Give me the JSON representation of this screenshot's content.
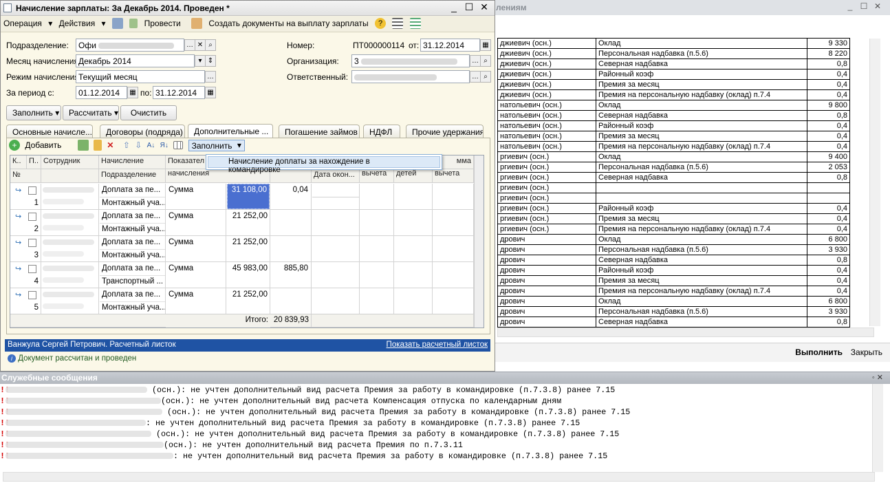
{
  "right_window": {
    "title_fragment": "лениям",
    "rows": [
      {
        "name": "джиевич  (осн.)",
        "type": "Оклад",
        "value": "9 330"
      },
      {
        "name": "джиевич  (осн.)",
        "type": "Персональная надбавка (п.5.6)",
        "value": "8 220"
      },
      {
        "name": "джиевич  (осн.)",
        "type": "Северная надбавка",
        "value": "0,8"
      },
      {
        "name": "джиевич  (осн.)",
        "type": "Районный коэф",
        "value": "0,4"
      },
      {
        "name": "джиевич  (осн.)",
        "type": "Премия за месяц",
        "value": "0,4"
      },
      {
        "name": "джиевич  (осн.)",
        "type": "Премия на персональную надбавку (оклад) п.7.4",
        "value": "0,4"
      },
      {
        "name": "натольевич  (осн.)",
        "type": "Оклад",
        "value": "9 800"
      },
      {
        "name": "натольевич  (осн.)",
        "type": "Северная надбавка",
        "value": "0,8"
      },
      {
        "name": "натольевич  (осн.)",
        "type": "Районный коэф",
        "value": "0,4"
      },
      {
        "name": "натольевич  (осн.)",
        "type": "Премия за месяц",
        "value": "0,4"
      },
      {
        "name": "натольевич  (осн.)",
        "type": "Премия на персональную надбавку (оклад) п.7.4",
        "value": "0,4"
      },
      {
        "name": "ргиевич  (осн.)",
        "type": "Оклад",
        "value": "9 400"
      },
      {
        "name": "ргиевич  (осн.)",
        "type": "Персональная надбавка (п.5.6)",
        "value": "2 053"
      },
      {
        "name": "ргиевич  (осн.)",
        "type": "Северная надбавка",
        "value": "0,8"
      },
      {
        "name": "ргиевич  (осн.)",
        "type": "",
        "value": ""
      },
      {
        "name": "ргиевич  (осн.)",
        "type": "",
        "value": ""
      },
      {
        "name": "ргиевич  (осн.)",
        "type": "Районный коэф",
        "value": "0,4"
      },
      {
        "name": "ргиевич  (осн.)",
        "type": "Премия за месяц",
        "value": "0,4"
      },
      {
        "name": "ргиевич  (осн.)",
        "type": "Премия на персональную надбавку (оклад) п.7.4",
        "value": "0,4"
      },
      {
        "name": "дрович",
        "type": "Оклад",
        "value": "6 800"
      },
      {
        "name": "дрович",
        "type": "Персональная надбавка (п.5.6)",
        "value": "3 930"
      },
      {
        "name": "дрович",
        "type": "Северная надбавка",
        "value": "0,8"
      },
      {
        "name": "дрович",
        "type": "Районный коэф",
        "value": "0,4"
      },
      {
        "name": "дрович",
        "type": "Премия за месяц",
        "value": "0,4"
      },
      {
        "name": "дрович",
        "type": "Премия на персональную надбавку (оклад) п.7.4",
        "value": "0,4"
      },
      {
        "name": "дрович",
        "type": "Оклад",
        "value": "6 800"
      },
      {
        "name": "дрович",
        "type": "Персональная надбавка (п.5.6)",
        "value": "3 930"
      },
      {
        "name": "дрович",
        "type": "Северная надбавка",
        "value": "0,8"
      }
    ],
    "run_label": "Выполнить",
    "close_label": "Закрыть"
  },
  "main": {
    "title": "Начисление зарплаты: За Декабрь 2014. Проведен *",
    "toolbar": {
      "operation": "Операция",
      "actions": "Действия",
      "post": "Провести",
      "create_docs": "Создать документы на выплату зарплаты"
    },
    "form": {
      "department_label": "Подразделение:",
      "department_value": "Офи",
      "month_label": "Месяц начисления:",
      "month_value": "Декабрь 2014",
      "mode_label": "Режим начисления:",
      "mode_value": "Текущий месяц",
      "period_label": "За период с:",
      "period_from": "01.12.2014",
      "period_to_label": "по:",
      "period_to": "31.12.2014",
      "number_label": "Номер:",
      "number_value": "ПТ000000114",
      "date_label": "от:",
      "date_value": "31.12.2014",
      "org_label": "Организация:",
      "org_value": "3",
      "resp_label": "Ответственный:"
    },
    "buttons": {
      "fill": "Заполнить",
      "calc": "Рассчитать",
      "clear": "Очистить"
    },
    "tabs": [
      "Основные начисле...",
      "Договоры (подряда)",
      "Дополнительные ...",
      "Погашение займов",
      "НДФЛ",
      "Прочие удержания"
    ],
    "grid_toolbar": {
      "add": "Добавить",
      "fill": "Заполнить"
    },
    "dropdown_item": "Начисление доплаты за нахождение в командировке",
    "grid_headers": {
      "k": "К..",
      "p": "П..",
      "employee": "Сотрудник",
      "no": "№",
      "accrual": "Начисление",
      "department": "Подразделение",
      "indicator": "Показател",
      "indicator2": "начисления",
      "end_date": "Дата окон...",
      "deduct": "вычета",
      "children": "детей",
      "sum_fragment": "мма",
      "deduct2": "вычета"
    },
    "grid_rows": [
      {
        "n": "1",
        "accrual": "Доплата за пе...",
        "dept": "Монтажный уча...",
        "indicator": "Сумма",
        "amount": "31 108,00",
        "extra": "0,04"
      },
      {
        "n": "2",
        "accrual": "Доплата за пе...",
        "dept": "Монтажный уча...",
        "indicator": "Сумма",
        "amount": "21 252,00",
        "extra": ""
      },
      {
        "n": "3",
        "accrual": "Доплата за пе...",
        "dept": "Монтажный уча...",
        "indicator": "Сумма",
        "amount": "21 252,00",
        "extra": ""
      },
      {
        "n": "4",
        "accrual": "Доплата за пе...",
        "dept": "Транспортный ...",
        "indicator": "Сумма",
        "amount": "45 983,00",
        "extra": "885,80"
      },
      {
        "n": "5",
        "accrual": "Доплата за пе...",
        "dept": "Монтажный уча...",
        "indicator": "Сумма",
        "amount": "21 252,00",
        "extra": ""
      }
    ],
    "total_label": "Итого:",
    "total_value": "20 839,93",
    "payslip_text": "Ванжула Сергей Петрович. Расчетный листок",
    "payslip_link": "Показать расчетный листок",
    "status_text": "Документ рассчитан и проведен"
  },
  "messages": {
    "title": "Служебные сообщения",
    "lines": [
      " (осн.): не учтен дополнительный вид расчета Премия за работу в командировке (п.7.3.8) ранее 7.15",
      "(осн.): не учтен дополнительный вид расчета Компенсация отпуска по календарным дням",
      " (осн.): не учтен дополнительный вид расчета Премия за работу в командировке (п.7.3.8) ранее 7.15",
      ": не учтен дополнительный вид расчета Премия за работу в командировке (п.7.3.8) ранее 7.15",
      "  (осн.): не учтен дополнительный вид расчета Премия за работу в командировке (п.7.3.8) ранее 7.15",
      "(осн.): не учтен дополнительный вид расчета Премия по п.7.3.11",
      ": не учтен дополнительный вид расчета Премия за работу в командировке (п.7.3.8) ранее 7.15"
    ]
  },
  "colors": {
    "accent_blue": "#1f53a4",
    "form_bg": "#fbf8e8",
    "selected_cell": "#4a6fd0",
    "error_mark": "#d40000"
  }
}
